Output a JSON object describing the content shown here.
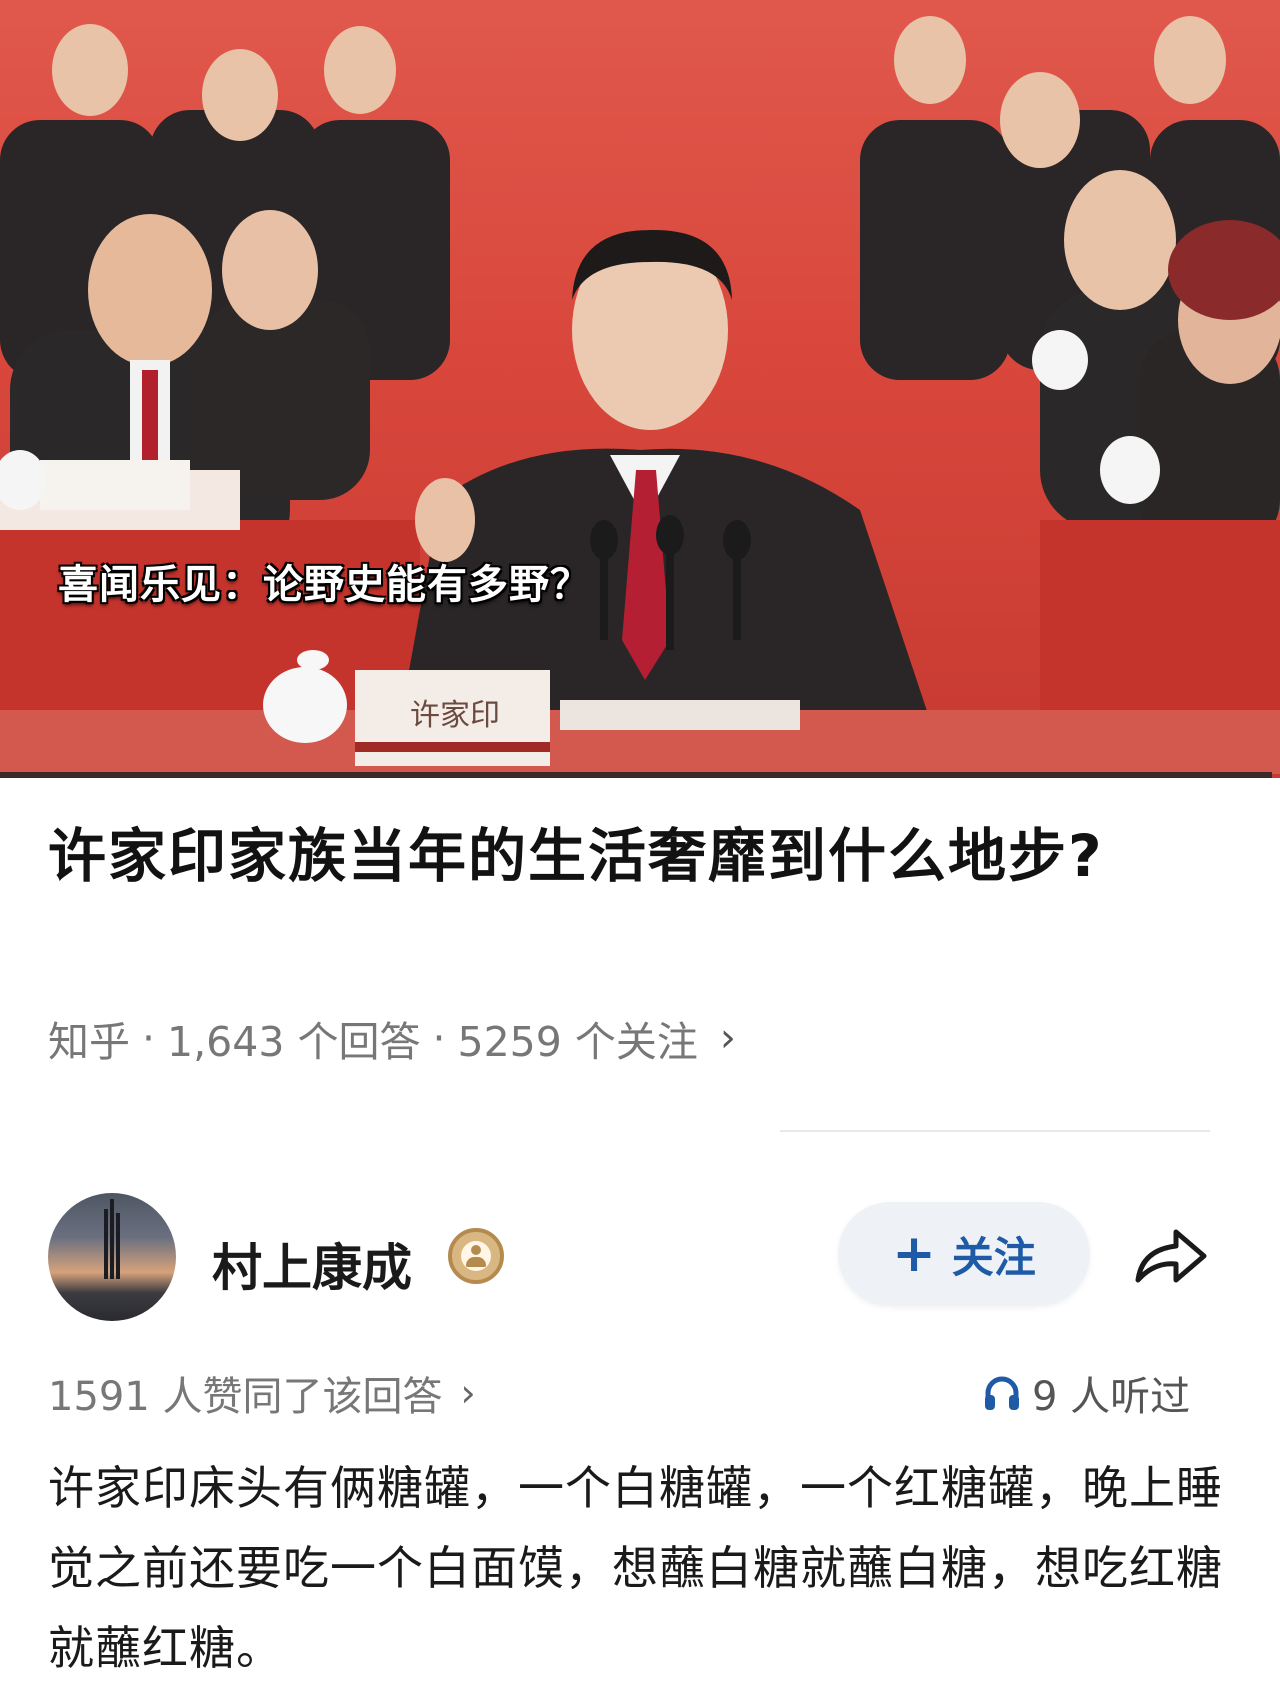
{
  "hero": {
    "caption": "喜闻乐见：论野史能有多野？",
    "nameplate": "许家印"
  },
  "question": {
    "title": "许家印家族当年的生活奢靡到什么地步?",
    "source": "知乎",
    "answers": "1,643 个回答",
    "followers": "5259 个关注",
    "separator": "·"
  },
  "author": {
    "name": "村上康成",
    "follow_label": "关注",
    "follow_icon": "plus-icon",
    "badge_icon": "user-badge-icon",
    "share_icon": "share-arrow-icon"
  },
  "stats": {
    "likes": "1591 人赞同了该回答",
    "listens": "9 人听过",
    "listen_icon": "headphones-icon",
    "accent_color": "#1f5aa6"
  },
  "answer": {
    "text": "许家印床头有俩糖罐，一个白糖罐，一个红糖罐，晚上睡觉之前还要吃一个白面馍，想蘸白糖就蘸白糖，想吃红糖就蘸红糖。"
  }
}
